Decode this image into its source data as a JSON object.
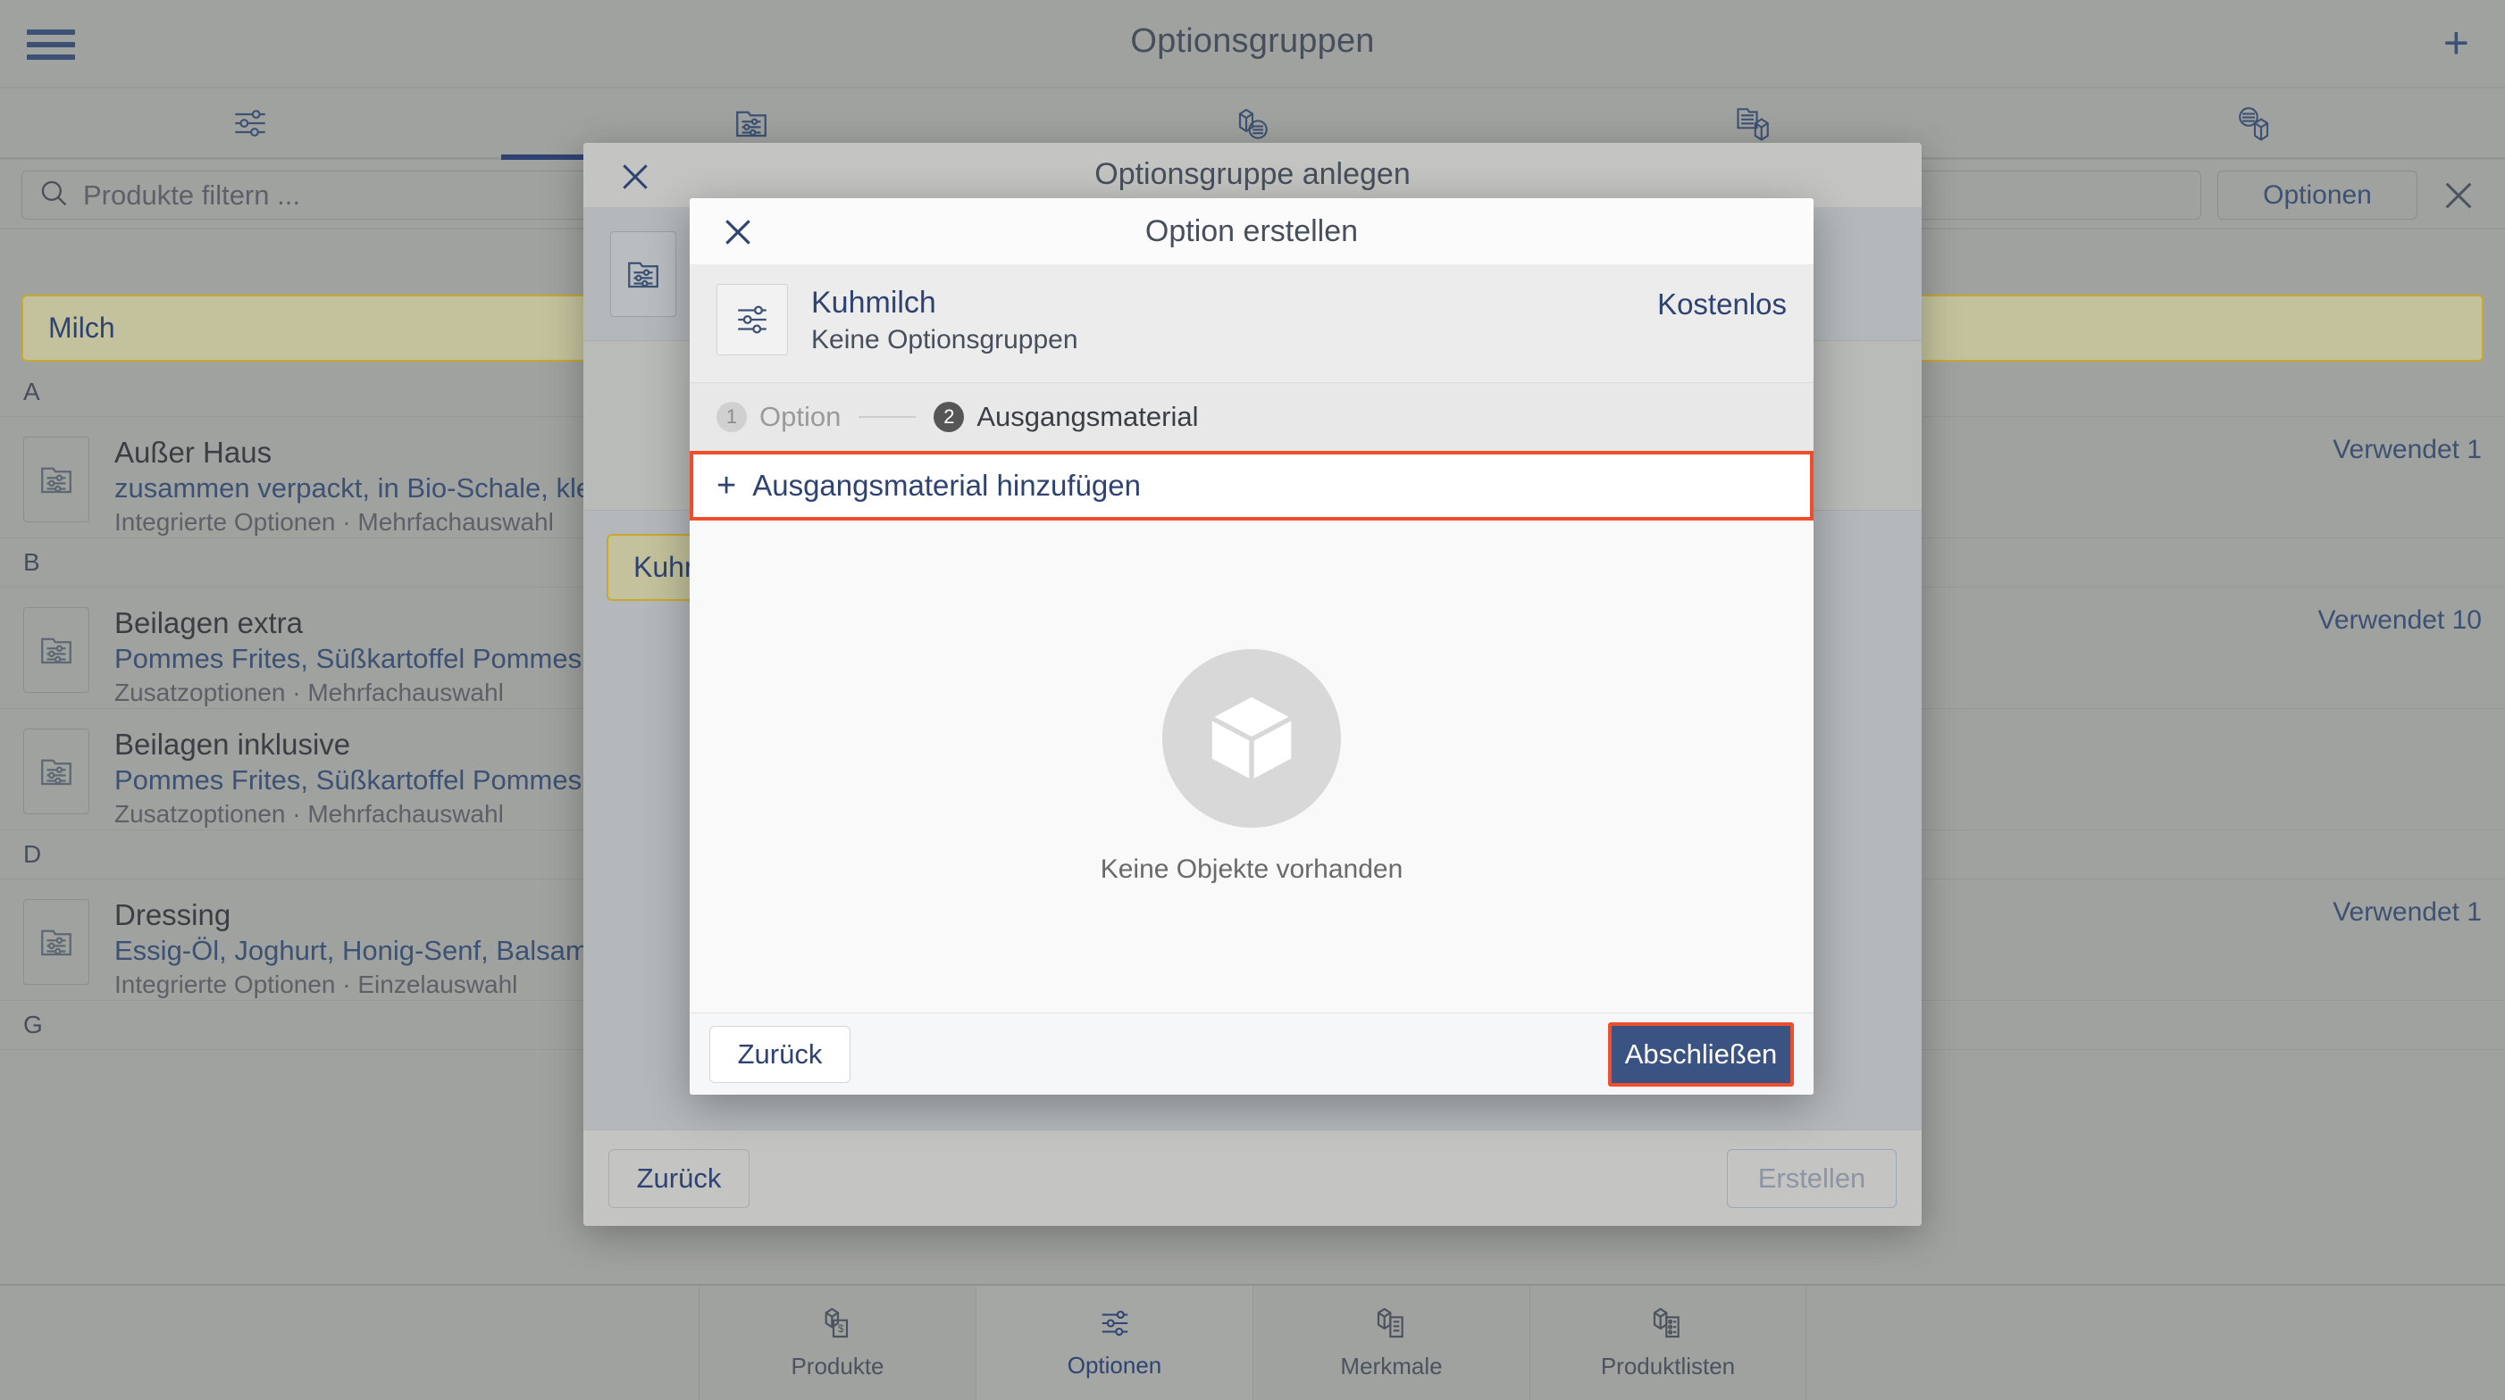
{
  "app": {
    "header": {
      "title": "Optionsgruppen",
      "menu_icon": "hamburger-icon",
      "add_icon": "plus-icon"
    },
    "tabs": [
      {
        "icon": "sliders-icon",
        "active": false
      },
      {
        "icon": "folder-sliders-icon",
        "active": true
      },
      {
        "icon": "cube-sliders-icon",
        "active": false
      },
      {
        "icon": "folder-cube-icon",
        "active": false
      },
      {
        "icon": "sliders-cube-icon",
        "active": false
      }
    ],
    "filterbar": {
      "search_placeholder": "Produkte filtern ...",
      "search_value": "",
      "search_icon": "search-icon",
      "options_button": "Optionen",
      "close_icon": "close-icon"
    },
    "selected_row": {
      "label": "Milch"
    },
    "list": [
      {
        "type": "section",
        "label": "A"
      },
      {
        "type": "row",
        "title": "Außer Haus",
        "subtitle": "zusammen verpackt, in Bio-Schale, kleiner Salat, Lieferkosten anteilig",
        "meta": "Integrierte Optionen · Mehrfachauswahl",
        "used_label": "Verwendet 1",
        "icon": "folder-sliders-icon"
      },
      {
        "type": "section",
        "label": "B"
      },
      {
        "type": "row",
        "title": "Beilagen extra",
        "subtitle": "Pommes Frites, Süßkartoffel Pommes",
        "meta": "Zusatzoptionen · Mehrfachauswahl",
        "used_label": "Verwendet 10",
        "icon": "folder-sliders-icon"
      },
      {
        "type": "row",
        "title": "Beilagen inklusive",
        "subtitle": "Pommes Frites, Süßkartoffel Pommes",
        "meta": "Zusatzoptionen · Mehrfachauswahl",
        "used_label": "",
        "icon": "folder-sliders-icon"
      },
      {
        "type": "section",
        "label": "D"
      },
      {
        "type": "row",
        "title": "Dressing",
        "subtitle": "Essig-Öl, Joghurt, Honig-Senf, Balsamico",
        "meta": "Integrierte Optionen · Einzelauswahl",
        "used_label": "Verwendet 1",
        "icon": "folder-sliders-icon"
      },
      {
        "type": "section",
        "label": "G"
      }
    ],
    "bottom_nav": [
      {
        "label": "Produkte",
        "icon": "product-cube-icon",
        "active": false
      },
      {
        "label": "Optionen",
        "icon": "sliders-icon",
        "active": true
      },
      {
        "label": "Merkmale",
        "icon": "cube-list-icon",
        "active": false
      },
      {
        "label": "Produktlisten",
        "icon": "cube-list-alt-icon",
        "active": false
      }
    ]
  },
  "outer_modal": {
    "title": "Optionsgruppe anlegen",
    "close_icon": "close-icon",
    "thumb_icon": "folder-sliders-icon",
    "chip_label": "Kuhmilch",
    "back_button": "Zurück",
    "create_button": "Erstellen"
  },
  "inner_modal": {
    "title": "Option erstellen",
    "close_icon": "close-icon",
    "product": {
      "name": "Kuhmilch",
      "subtitle": "Keine Optionsgruppen",
      "price": "Kostenlos",
      "icon": "sliders-icon"
    },
    "stepper": {
      "steps": [
        {
          "number": "1",
          "label": "Option",
          "active": false
        },
        {
          "number": "2",
          "label": "Ausgangsmaterial",
          "active": true
        }
      ]
    },
    "add_row": {
      "plus": "+",
      "label": "Ausgangsmaterial hinzufügen",
      "highlight_color": "#ef4e2a"
    },
    "empty_state": {
      "icon": "cube-icon",
      "text": "Keine Objekte vorhanden"
    },
    "footer": {
      "back_button": "Zurück",
      "finish_button": "Abschließen",
      "finish_color": "#3a5382",
      "finish_highlight_color": "#ef4e2a"
    }
  }
}
